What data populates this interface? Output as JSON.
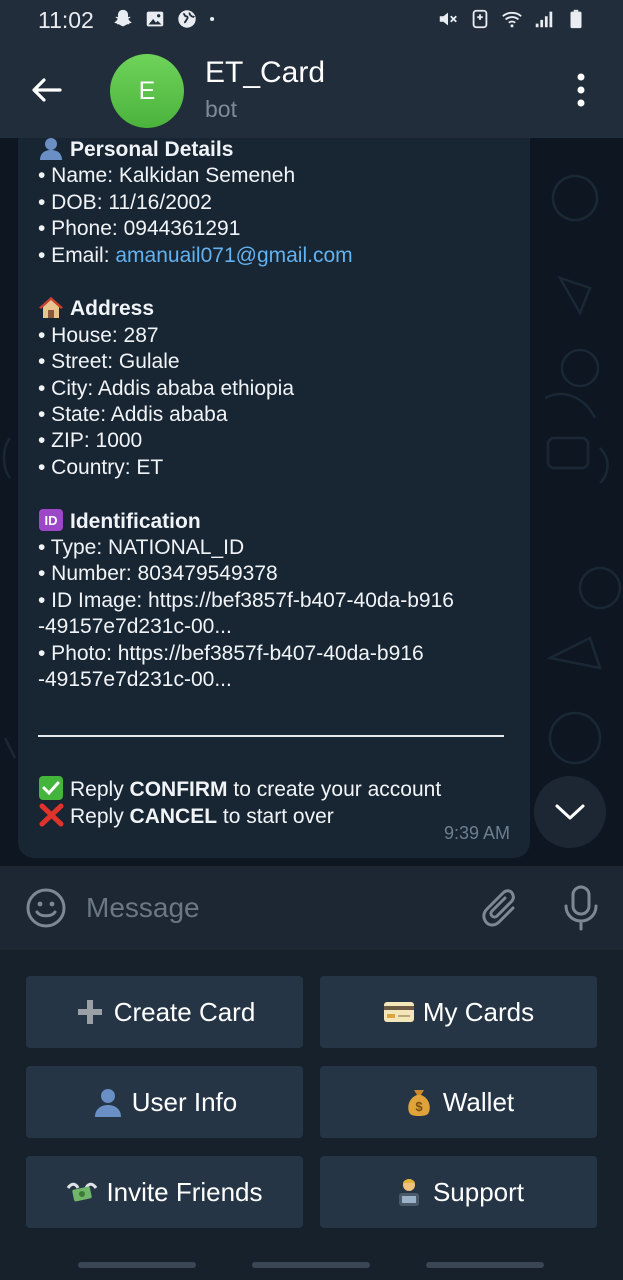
{
  "status_bar": {
    "time": "11:02"
  },
  "header": {
    "avatar_letter": "E",
    "title": "ET_Card",
    "subtitle": "bot",
    "accent": "#4bb33c"
  },
  "message": {
    "personal": {
      "heading": "Personal Details",
      "name": "• Name: Kalkidan Semeneh",
      "dob": "• DOB: 11/16/2002",
      "phone": "• Phone: 0944361291",
      "email_label": "• Email: ",
      "email": "amanuail071@gmail.com"
    },
    "address": {
      "heading": "Address",
      "house": "• House: 287",
      "street": "• Street: Gulale",
      "city": "• City: Addis ababa ethiopia",
      "state": "• State: Addis ababa",
      "zip": "• ZIP: 1000",
      "country": "• Country: ET"
    },
    "identification": {
      "heading": "Identification",
      "type": "• Type: NATIONAL_ID",
      "number": "• Number: 803479549378",
      "id_image_1": "• ID Image: https://bef3857f-b407-40da-b916",
      "id_image_2": "-49157e7d231c-00...",
      "photo_1": "• Photo: https://bef3857f-b407-40da-b916",
      "photo_2": "-49157e7d231c-00..."
    },
    "confirm": {
      "prefix": "Reply ",
      "keyword": "CONFIRM",
      "suffix": " to create your account"
    },
    "cancel": {
      "prefix": "Reply ",
      "keyword": "CANCEL",
      "suffix": " to start over"
    },
    "time": "9:39 AM"
  },
  "input": {
    "placeholder": "Message"
  },
  "keyboard": {
    "create_card": "Create Card",
    "my_cards": "My Cards",
    "user_info": "User Info",
    "wallet": "Wallet",
    "invite_friends": "Invite Friends",
    "support": "Support"
  },
  "icons": {
    "status_left": [
      "snapchat-icon",
      "gallery-icon",
      "browser-icon",
      "dot-icon"
    ],
    "status_right": [
      "mute-icon",
      "data-saver-icon",
      "wifi-icon",
      "signal-icon",
      "battery-icon"
    ],
    "header": [
      "back-arrow-icon",
      "more-vert-icon"
    ],
    "input": [
      "emoji-icon",
      "paperclip-icon",
      "microphone-icon"
    ]
  }
}
